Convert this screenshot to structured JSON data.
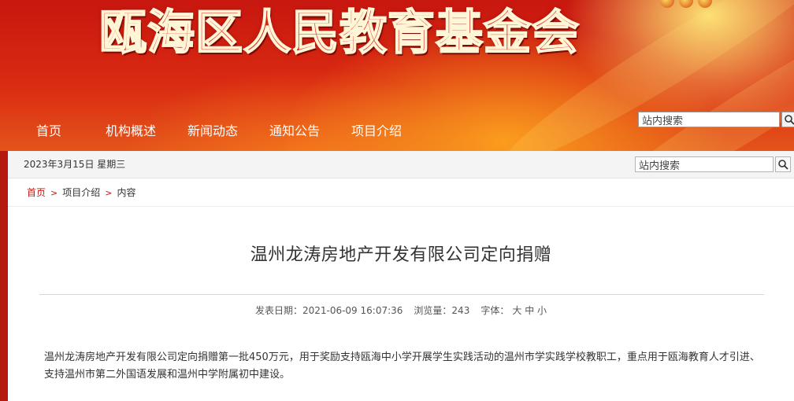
{
  "header": {
    "site_title": "瓯海区人民教育基金会",
    "nav": [
      "首页",
      "机构概述",
      "新闻动态",
      "通知公告",
      "项目介绍"
    ],
    "search_placeholder": "站内搜索"
  },
  "infobar": {
    "date": "2023年3月15日 星期三",
    "search_placeholder": "站内搜索"
  },
  "breadcrumb": {
    "home": "首页",
    "sep": ">",
    "section": "项目介绍",
    "current": "内容"
  },
  "article": {
    "title": "温州龙涛房地产开发有限公司定向捐赠",
    "meta": {
      "date_label": "发表日期：",
      "date": "2021-06-09 16:07:36",
      "views_label": "浏览量：",
      "views": "243",
      "font_label": "字体：",
      "font_large": "大",
      "font_medium": "中",
      "font_small": "小"
    },
    "body": "温州龙涛房地产开发有限公司定向捐赠第一批450万元，用于奖励支持瓯海中小学开展学生实践活动的温州市学实践学校教职工，重点用于瓯海教育人才引进、支持温州市第二外国语发展和温州中学附属初中建设。"
  },
  "colors": {
    "brand_red": "#c21a10",
    "banner_gold": "#ffd860"
  }
}
